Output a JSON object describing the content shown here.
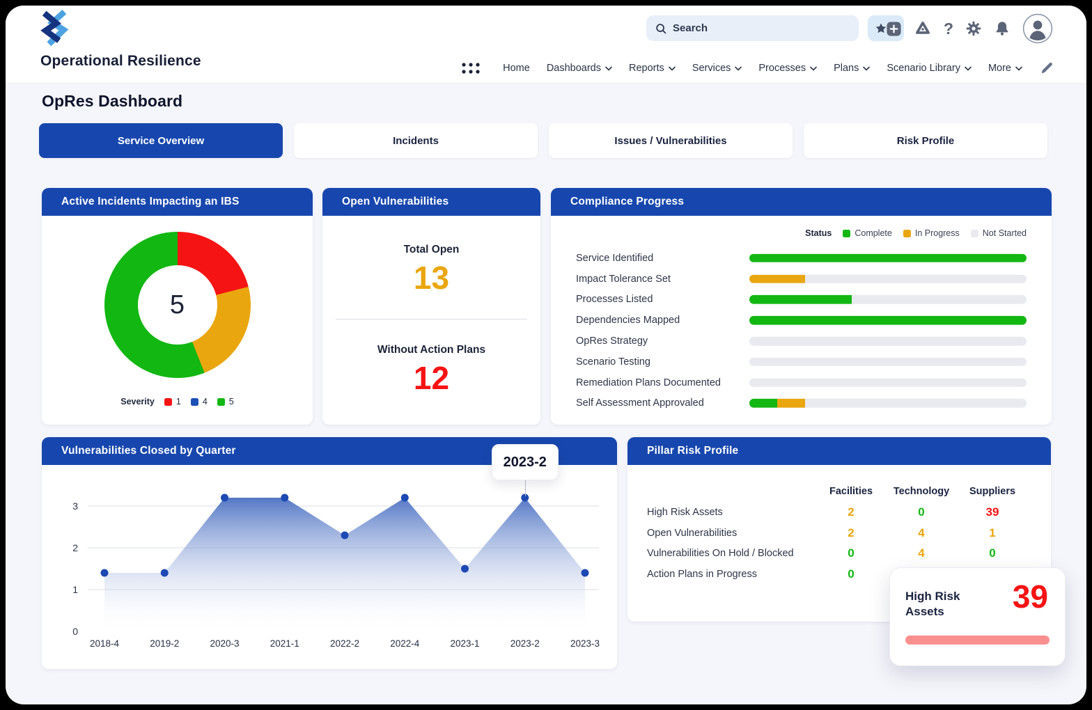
{
  "app": {
    "title": "Operational Resilience"
  },
  "topbar": {
    "search_placeholder": "Search",
    "nav": [
      {
        "label": "Home",
        "menu": false
      },
      {
        "label": "Dashboards",
        "menu": true
      },
      {
        "label": "Reports",
        "menu": true
      },
      {
        "label": "Services",
        "menu": true
      },
      {
        "label": "Processes",
        "menu": true
      },
      {
        "label": "Plans",
        "menu": true
      },
      {
        "label": "Scenario Library",
        "menu": true
      },
      {
        "label": "More",
        "menu": true
      }
    ]
  },
  "page": {
    "title": "OpRes Dashboard"
  },
  "tabs": [
    {
      "label": "Service Overview",
      "active": true
    },
    {
      "label": "Incidents",
      "active": false
    },
    {
      "label": "Issues / Vulnerabilities",
      "active": false
    },
    {
      "label": "Risk Profile",
      "active": false
    }
  ],
  "cards": {
    "open_vulnerabilities": {
      "title": "Open Vulnerabilities",
      "total_open_label": "Total Open",
      "total_open_value": "13",
      "without_plans_label": "Without Action Plans",
      "without_plans_value": "12"
    },
    "pillar_overlay": {
      "title": "High Risk Assets",
      "value": "39"
    }
  },
  "colors": {
    "header_blue": "#1747ae",
    "green": "#12b712",
    "amber": "#eaa60f",
    "red": "#f61313",
    "legend_blue": "#1d50b5",
    "track": "#e8eaef",
    "pink_bar": "#f9908f"
  },
  "chart_data": [
    {
      "type": "pie",
      "title": "Active Incidents Impacting an IBS",
      "center_value": "5",
      "legend_title": "Severity",
      "slices": [
        {
          "label": "1",
          "pct": 21,
          "color": "red",
          "legend_color": "red"
        },
        {
          "label": "4",
          "pct": 23,
          "color": "amber",
          "legend_color": "legend_blue"
        },
        {
          "label": "5",
          "pct": 56,
          "color": "green",
          "legend_color": "green"
        }
      ]
    },
    {
      "type": "bar",
      "title": "Compliance Progress",
      "legend_title": "Status",
      "series": [
        {
          "name": "Complete",
          "color": "green"
        },
        {
          "name": "In Progress",
          "color": "amber"
        },
        {
          "name": "Not Started",
          "color": "track"
        }
      ],
      "categories": [
        "Service Identified",
        "Impact Tolerance Set",
        "Processes Listed",
        "Dependencies Mapped",
        "OpRes Strategy",
        "Scenario Testing",
        "Remediation Plans Documented",
        "Self Assessment Approvaled"
      ],
      "values": [
        {
          "complete": 100,
          "in_progress": 0
        },
        {
          "complete": 0,
          "in_progress": 20
        },
        {
          "complete": 37,
          "in_progress": 0
        },
        {
          "complete": 100,
          "in_progress": 0
        },
        {
          "complete": 0,
          "in_progress": 0
        },
        {
          "complete": 0,
          "in_progress": 0
        },
        {
          "complete": 0,
          "in_progress": 0
        },
        {
          "complete": 10,
          "in_progress": 10
        }
      ]
    },
    {
      "type": "area",
      "title": "Vulnerabilities Closed by Quarter",
      "x": [
        "2018-4",
        "2019-2",
        "2020-3",
        "2021-1",
        "2022-2",
        "2022-4",
        "2023-1",
        "2023-2",
        "2023-3"
      ],
      "values": [
        1.4,
        1.4,
        3.2,
        3.2,
        2.3,
        3.2,
        1.5,
        3.2,
        1.4
      ],
      "yticks": [
        0,
        1,
        2,
        3
      ],
      "ylim": [
        0,
        3.6
      ],
      "tooltip": {
        "label": "2023-2",
        "index": 7
      },
      "fill_top": "#4b70c2",
      "dot_color": "#1d49b2",
      "grid": true
    },
    {
      "type": "table",
      "title": "Pillar Risk Profile",
      "columns": [
        "Facilities",
        "Technology",
        "Suppliers"
      ],
      "rows": [
        {
          "label": "High Risk Assets",
          "values": [
            {
              "v": "2",
              "color": "amber"
            },
            {
              "v": "0",
              "color": "green"
            },
            {
              "v": "39",
              "color": "red"
            }
          ]
        },
        {
          "label": "Open Vulnerabilities",
          "values": [
            {
              "v": "2",
              "color": "amber"
            },
            {
              "v": "4",
              "color": "amber"
            },
            {
              "v": "1",
              "color": "amber"
            }
          ]
        },
        {
          "label": "Vulnerabilities On Hold / Blocked",
          "values": [
            {
              "v": "0",
              "color": "green"
            },
            {
              "v": "4",
              "color": "amber"
            },
            {
              "v": "0",
              "color": "green"
            }
          ]
        },
        {
          "label": "Action Plans in Progress",
          "values": [
            {
              "v": "0",
              "color": "green"
            },
            null,
            null
          ]
        }
      ]
    }
  ]
}
